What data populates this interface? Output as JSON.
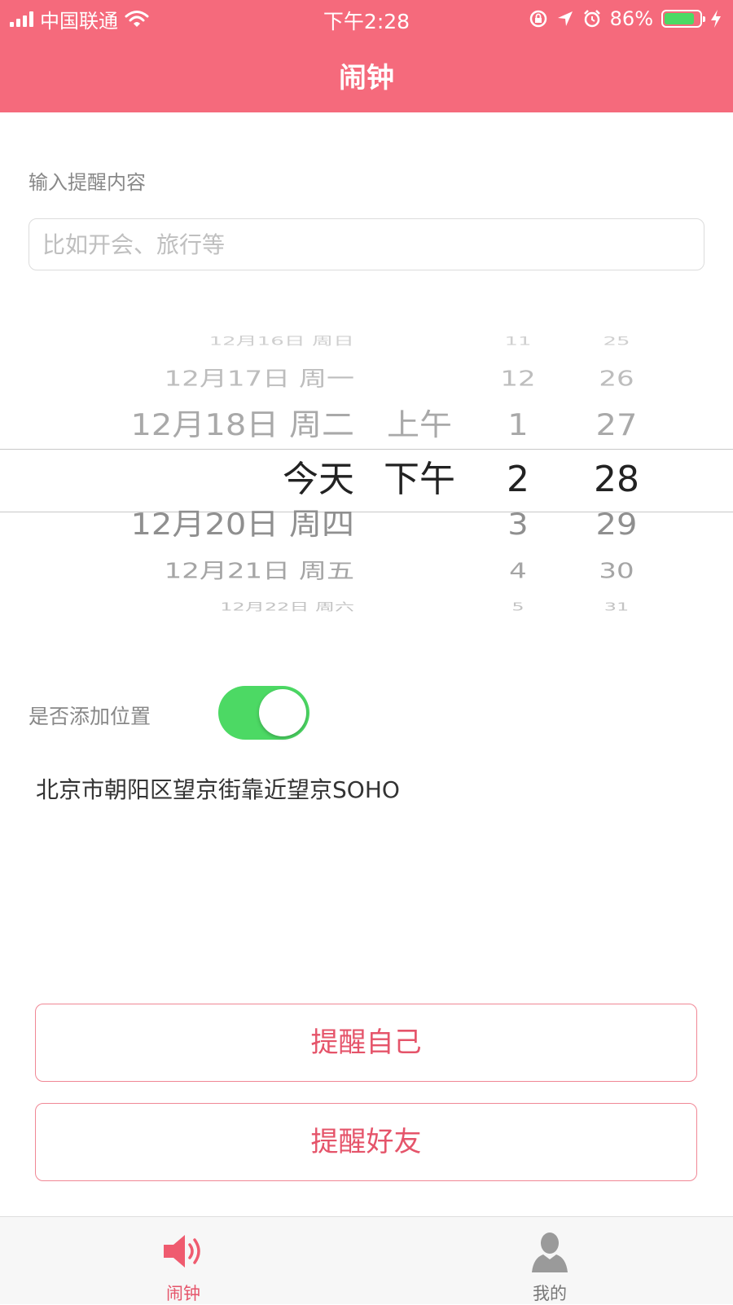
{
  "status_bar": {
    "carrier": "中国联通",
    "time": "下午2:28",
    "battery_percent": "86%",
    "battery_level": 0.86,
    "icons": [
      "signal-icon",
      "wifi-icon",
      "rotation-lock-icon",
      "location-arrow-icon",
      "alarm-icon",
      "battery-icon",
      "charging-icon"
    ]
  },
  "nav": {
    "title": "闹钟"
  },
  "reminder": {
    "label": "输入提醒内容",
    "placeholder": "比如开会、旅行等",
    "value": ""
  },
  "picker": {
    "date_column": {
      "above": [
        "12月16日 周日",
        "12月17日 周一",
        "12月18日 周二"
      ],
      "selected": "今天",
      "below": [
        "12月20日 周四",
        "12月21日 周五",
        "12月22日 周六"
      ]
    },
    "ampm_column": {
      "above": [
        "上午"
      ],
      "selected": "下午",
      "below": []
    },
    "hour_column": {
      "above": [
        "11",
        "12",
        "1"
      ],
      "selected": "2",
      "below": [
        "3",
        "4",
        "5"
      ]
    },
    "minute_column": {
      "above": [
        "25",
        "26",
        "27"
      ],
      "selected": "28",
      "below": [
        "29",
        "30",
        "31"
      ]
    }
  },
  "location": {
    "label": "是否添加位置",
    "enabled": true,
    "address": "北京市朝阳区望京街靠近望京SOHO"
  },
  "actions": {
    "remind_self": "提醒自己",
    "remind_friend": "提醒好友"
  },
  "tabbar": {
    "tabs": [
      {
        "label": "闹钟",
        "icon": "speaker-icon",
        "active": true
      },
      {
        "label": "我的",
        "icon": "person-icon",
        "active": false
      }
    ]
  },
  "colors": {
    "brand": "#f56a7c",
    "accent_text": "#e5546a",
    "toggle_on": "#4cd964"
  }
}
